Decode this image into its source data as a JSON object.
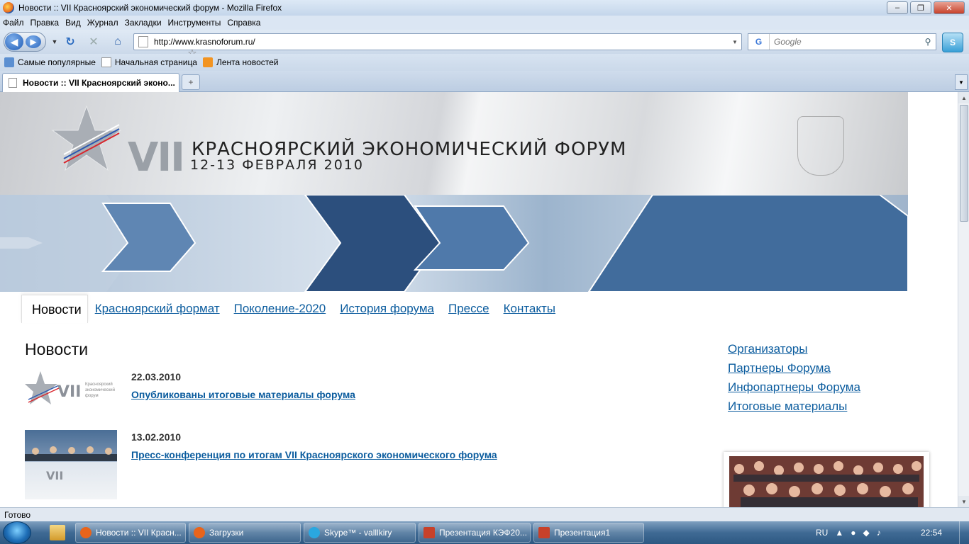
{
  "window": {
    "title": "Новости :: VII Красноярский экономический форум - Mozilla Firefox"
  },
  "menu": [
    "Файл",
    "Правка",
    "Вид",
    "Журнал",
    "Закладки",
    "Инструменты",
    "Справка"
  ],
  "address": {
    "url": "http://www.krasnoforum.ru/"
  },
  "search": {
    "placeholder": "Google",
    "engine_icon": "G"
  },
  "bookmarks": [
    {
      "label": "Самые популярные",
      "icon": "smart-folder-icon"
    },
    {
      "label": "Начальная страница",
      "icon": "page-icon"
    },
    {
      "label": "Лента новостей",
      "icon": "rss-icon"
    }
  ],
  "tab": {
    "label": "Новости :: VII Красноярский эконо...",
    "new_tab_glyph": "+"
  },
  "banner": {
    "roman": "VII",
    "title": "КРАСНОЯРСКИЙ ЭКОНОМИЧЕСКИЙ ФОРУМ",
    "dates": "12-13 ФЕВРАЛЯ 2010"
  },
  "nav": {
    "active": "Новости",
    "items": [
      "Красноярский формат",
      "Поколение-2020",
      "История форума",
      "Прессе",
      "Контакты"
    ]
  },
  "page_title": "Новости",
  "news": [
    {
      "date": "22.03.2010",
      "title": "Опубликованы итоговые материалы форума",
      "logo_text": "Красноярский экономический форум"
    },
    {
      "date": "13.02.2010",
      "title": "Пресс-конференция по итогам VII Красноярского экономического форума"
    }
  ],
  "sidebar": [
    "Организаторы",
    "Партнеры Форума",
    "Инфопартнеры Форума",
    "Итоговые материалы"
  ],
  "status": "Готово",
  "taskbar": {
    "items": [
      {
        "label": "Новости :: VII Красн...",
        "color": "#e8641b"
      },
      {
        "label": "Загрузки",
        "color": "#e8641b"
      },
      {
        "label": "Skype™ - valllkiry",
        "color": "#2aa7e0"
      },
      {
        "label": "Презентация КЭФ20...",
        "color": "#c7412a"
      },
      {
        "label": "Презентация1",
        "color": "#c7412a"
      }
    ],
    "lang": "RU",
    "time": "22:54"
  }
}
